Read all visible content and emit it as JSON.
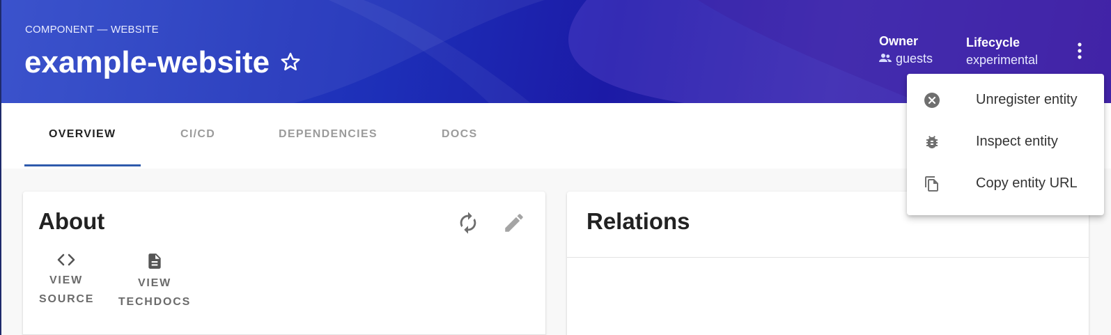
{
  "header": {
    "breadcrumb": "COMPONENT — WEBSITE",
    "title": "example-website",
    "owner_label": "Owner",
    "owner_value": "guests",
    "lifecycle_label": "Lifecycle",
    "lifecycle_value": "experimental"
  },
  "tabs": [
    {
      "label": "OVERVIEW",
      "active": true
    },
    {
      "label": "CI/CD",
      "active": false
    },
    {
      "label": "DEPENDENCIES",
      "active": false
    },
    {
      "label": "DOCS",
      "active": false
    }
  ],
  "about": {
    "title": "About",
    "links": [
      {
        "line1": "VIEW",
        "line2": "SOURCE",
        "icon": "code-icon"
      },
      {
        "line1": "VIEW",
        "line2": "TECHDOCS",
        "icon": "document-icon"
      }
    ]
  },
  "relations": {
    "title": "Relations"
  },
  "menu": {
    "items": [
      {
        "label": "Unregister entity",
        "icon": "cancel-circle-icon"
      },
      {
        "label": "Inspect entity",
        "icon": "bug-icon"
      },
      {
        "label": "Copy entity URL",
        "icon": "copy-icon"
      }
    ]
  },
  "colors": {
    "header_primary": "#1d2fb8",
    "tab_indicator": "#2e5aac",
    "active_tab_text": "#222222",
    "inactive_tab_text": "#9b9b9b"
  }
}
